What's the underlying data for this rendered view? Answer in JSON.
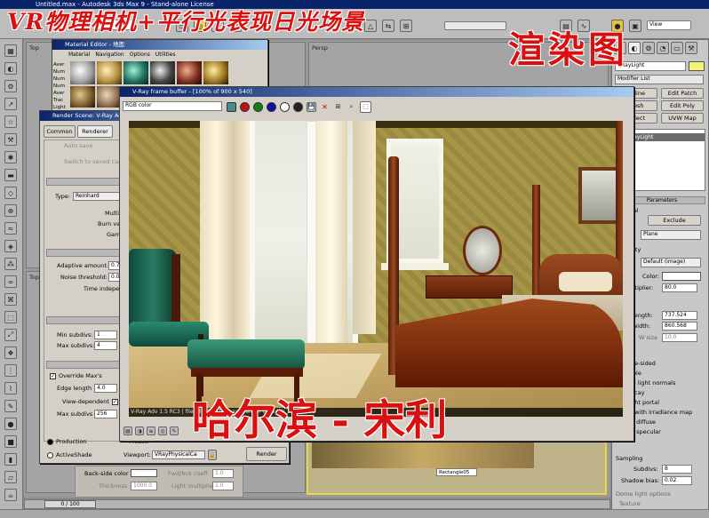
{
  "titles": {
    "app_title": "Untitled.max - Autodesk 3ds Max 9 - Stand-alone License",
    "overlay_title": "VR物理相机+平行光表现日光场景",
    "overlay_render": "渲染图",
    "overlay_author": "哈尔滨 - 宋利"
  },
  "toolbar": {
    "selection_filter": "All",
    "view_dropdown": "View"
  },
  "viewports": {
    "top_label": "Top",
    "persp_label": "Persp",
    "rectangle_label": "Rectangle05"
  },
  "command_panel": {
    "object_name": "VRayLight",
    "modifier_list": "Modifier List",
    "stack_item": "VRayLight",
    "buttons": [
      "Spline",
      "Edit Patch",
      "Mesh",
      "Edit Poly",
      "Select",
      "UVW Map"
    ],
    "parameters_title": "Parameters",
    "general_label": "General",
    "exclude_label": "Exclude",
    "type_value": "Plane",
    "intensity_label": "Intensity",
    "units_value": "Default (image)",
    "color_label": "Color:",
    "multiplier_label": "Multiplier:",
    "multiplier_value": "80.0",
    "half_length_label": "Half-length:",
    "half_length_value": "737.524",
    "half_width_label": "Half-width:",
    "half_width_value": "860.568",
    "w_size_label": "W size",
    "w_size_value": "10.0",
    "options": [
      "Double-sided",
      "Invisible",
      "Ignore light normals",
      "No decay",
      "Skylight portal",
      "Store with irradiance map",
      "Affect diffuse",
      "Affect specular"
    ],
    "sampling_title": "Sampling",
    "subdivs_label": "Subdivs:",
    "subdivs_value": "8",
    "shadow_bias_label": "Shadow bias:",
    "shadow_bias_value": "0.02",
    "dome_options_label": "Dome light options",
    "texture_label": "Texture",
    "use_texture_label": "Use texture"
  },
  "material_editor": {
    "title": "Material Editor - 地面",
    "menu": [
      "Material",
      "Navigation",
      "Options",
      "Utilities"
    ],
    "side_list": [
      "Aver",
      "Num",
      "Num",
      "Num",
      "Aver",
      "Trac",
      "Light"
    ]
  },
  "render_scene": {
    "title": "Render Scene: V-Ray Adv 1.5 RC3",
    "tabs": [
      "Common",
      "Renderer"
    ],
    "auto_save_label": "Auto save",
    "switch_cached_label": "Switch to saved cache",
    "type_label": "Type:",
    "type_value": "Reinhard",
    "multiplier_label": "Multiplier:",
    "burn_label": "Burn value:",
    "gamma_label": "Gamma:",
    "adaptive_amount_label": "Adaptive amount:",
    "adaptive_amount_value": "0.7",
    "noise_threshold_label": "Noise threshold:",
    "noise_threshold_value": "0.00",
    "time_independent_label": "Time independent",
    "min_subdivs_label": "Min subdivs:",
    "min_subdivs_value": "1",
    "max_subdivs_label": "Max subdivs:",
    "max_subdivs_value": "4",
    "override_label": "Override Max's",
    "edge_length_label": "Edge length",
    "edge_length_value": "4.0",
    "view_dependent_label": "View-dependent",
    "max_subdivs2_label": "Max subdivs",
    "max_subdivs2_value": "256",
    "production_label": "Production",
    "activeshade_label": "ActiveShade",
    "preset_label": "Preset:",
    "viewport_label": "Viewport:",
    "viewport_value": "VRayPhysicalCa",
    "render_button": "Render",
    "backside_label": "Back-side color",
    "fwd_back_label": "Fwd/bck coeff",
    "thickness_label": "Thickness",
    "thickness_value": "1000.0",
    "light_mult_label": "Light multiplier",
    "light_mult_value": "1.0",
    "fwd_value": "1.0"
  },
  "frame_buffer": {
    "title": "V-Ray frame buffer - [100% of 900 x 540]",
    "channel": "RGB color",
    "status": "V-Ray Adv 1.5 RC3  |  file: 卧室渲染12.max  |  render time: 2h 15m 23.3s"
  },
  "timeline": {
    "frame_counter": "0 / 100"
  }
}
